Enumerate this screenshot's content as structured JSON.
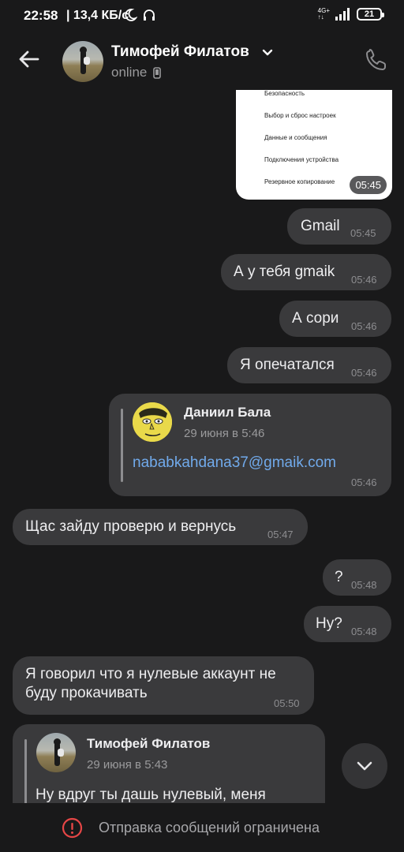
{
  "status_bar": {
    "time": "22:58",
    "speed": "| 13,4 КБ/с",
    "network": "4G+",
    "battery": "21"
  },
  "header": {
    "contact_name": "Тимофей Филатов",
    "status": "online"
  },
  "screenshot_preview": {
    "items": [
      "Безопасность",
      "Выбор и сброс настроек",
      "Данные и сообщения",
      "Подключения устройства",
      "Резервное копирование"
    ],
    "time": "05:45"
  },
  "messages": [
    {
      "text": "Gmail",
      "time": "05:45"
    },
    {
      "text": "А у тебя gmaik",
      "time": "05:46"
    },
    {
      "text": "А сори",
      "time": "05:46"
    },
    {
      "text": "Я опечатался",
      "time": "05:46"
    },
    {
      "forward_name": "Даниил Бала",
      "forward_date": "29 июня в 5:46",
      "text": "nababkahdana37@gmaik.com",
      "time": "05:46"
    },
    {
      "text": "Щас зайду проверю и вернусь",
      "time": "05:47"
    },
    {
      "text": "?",
      "time": "05:48"
    },
    {
      "text": "Ну?",
      "time": "05:48"
    },
    {
      "text": "Я говорил что я нулевые аккаунт не буду прокачивать",
      "time": "05:50"
    },
    {
      "forward_name": "Тимофей Филатов",
      "forward_date": "29 июня в 5:43",
      "text": "Ну вдруг ты дашь нулевый, меня"
    }
  ],
  "bottom_banner": {
    "text": "Отправка сообщений ограничена"
  },
  "colors": {
    "background": "#19191a",
    "bubble": "#3a3a3c",
    "link": "#71aaeb"
  }
}
